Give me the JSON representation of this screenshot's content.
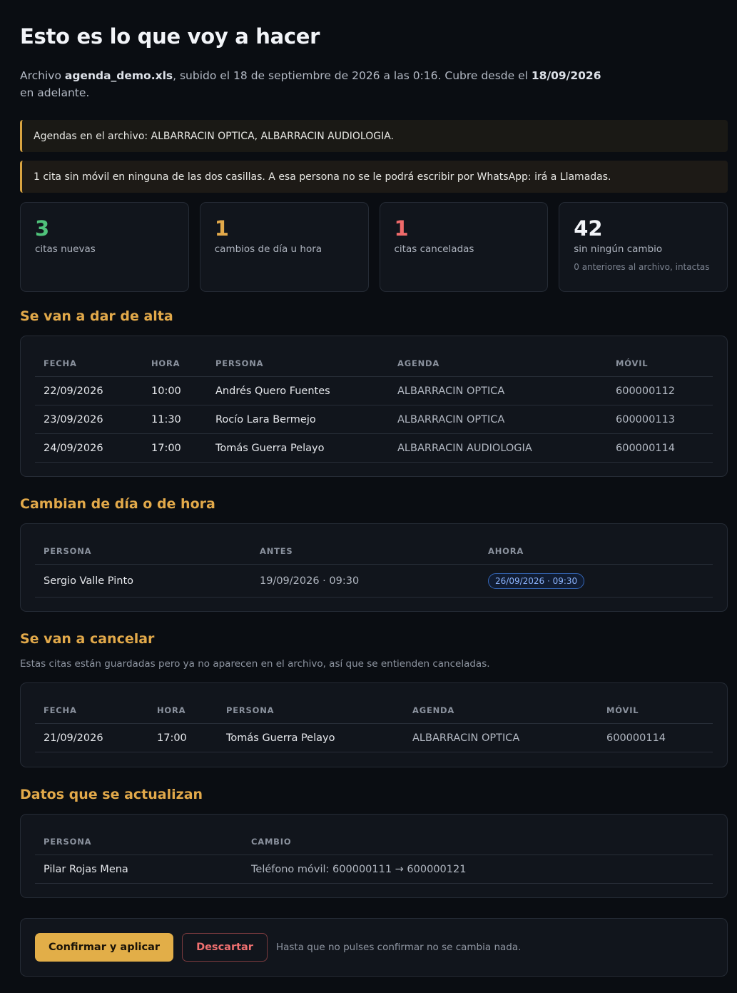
{
  "header": {
    "title": "Esto es lo que voy a hacer",
    "intro_prefix": "Archivo ",
    "file_name": "agenda_demo.xls",
    "intro_middle": ", subido el 18 de septiembre de 2026 a las 0:16. Cubre desde el ",
    "from_date": "18/09/2026",
    "intro_suffix": " en adelante."
  },
  "notices": [
    "Agendas en el archivo: ALBARRACIN OPTICA, ALBARRACIN AUDIOLOGIA.",
    "1 cita sin móvil en ninguna de las dos casillas. A esa persona no se le podrá escribir por WhatsApp: irá a Llamadas."
  ],
  "stats": [
    {
      "value": "3",
      "label": "citas nuevas",
      "sub": "",
      "color": "#4fc27a"
    },
    {
      "value": "1",
      "label": "cambios de día u hora",
      "sub": "",
      "color": "#e2a94a"
    },
    {
      "value": "1",
      "label": "citas canceladas",
      "sub": "",
      "color": "#ef6a6a"
    },
    {
      "value": "42",
      "label": "sin ningún cambio",
      "sub": "0 anteriores al archivo, intactas",
      "color": "#f2f4f8"
    }
  ],
  "new_section": {
    "title": "Se van a dar de alta",
    "headers": [
      "FECHA",
      "HORA",
      "PERSONA",
      "AGENDA",
      "MÓVIL"
    ],
    "rows": [
      [
        "22/09/2026",
        "10:00",
        "Andrés Quero Fuentes",
        "ALBARRACIN OPTICA",
        "600000112"
      ],
      [
        "23/09/2026",
        "11:30",
        "Rocío Lara Bermejo",
        "ALBARRACIN OPTICA",
        "600000113"
      ],
      [
        "24/09/2026",
        "17:00",
        "Tomás Guerra Pelayo",
        "ALBARRACIN AUDIOLOGIA",
        "600000114"
      ]
    ]
  },
  "change_section": {
    "title": "Cambian de día o de hora",
    "headers": [
      "PERSONA",
      "ANTES",
      "AHORA"
    ],
    "rows": [
      [
        "Sergio Valle Pinto",
        "19/09/2026 · 09:30",
        "26/09/2026 · 09:30"
      ]
    ]
  },
  "cancel_section": {
    "title": "Se van a cancelar",
    "description": "Estas citas están guardadas pero ya no aparecen en el archivo, así que se entienden canceladas.",
    "headers": [
      "FECHA",
      "HORA",
      "PERSONA",
      "AGENDA",
      "MÓVIL"
    ],
    "rows": [
      [
        "21/09/2026",
        "17:00",
        "Tomás Guerra Pelayo",
        "ALBARRACIN OPTICA",
        "600000114"
      ]
    ]
  },
  "update_section": {
    "title": "Datos que se actualizan",
    "headers": [
      "PERSONA",
      "CAMBIO"
    ],
    "rows": [
      [
        "Pilar Rojas Mena",
        "Teléfono móvil: 600000111 → 600000121"
      ]
    ]
  },
  "actions": {
    "confirm_label": "Confirmar y aplicar",
    "discard_label": "Descartar",
    "hint": "Hasta que no pulses confirmar no se cambia nada."
  }
}
